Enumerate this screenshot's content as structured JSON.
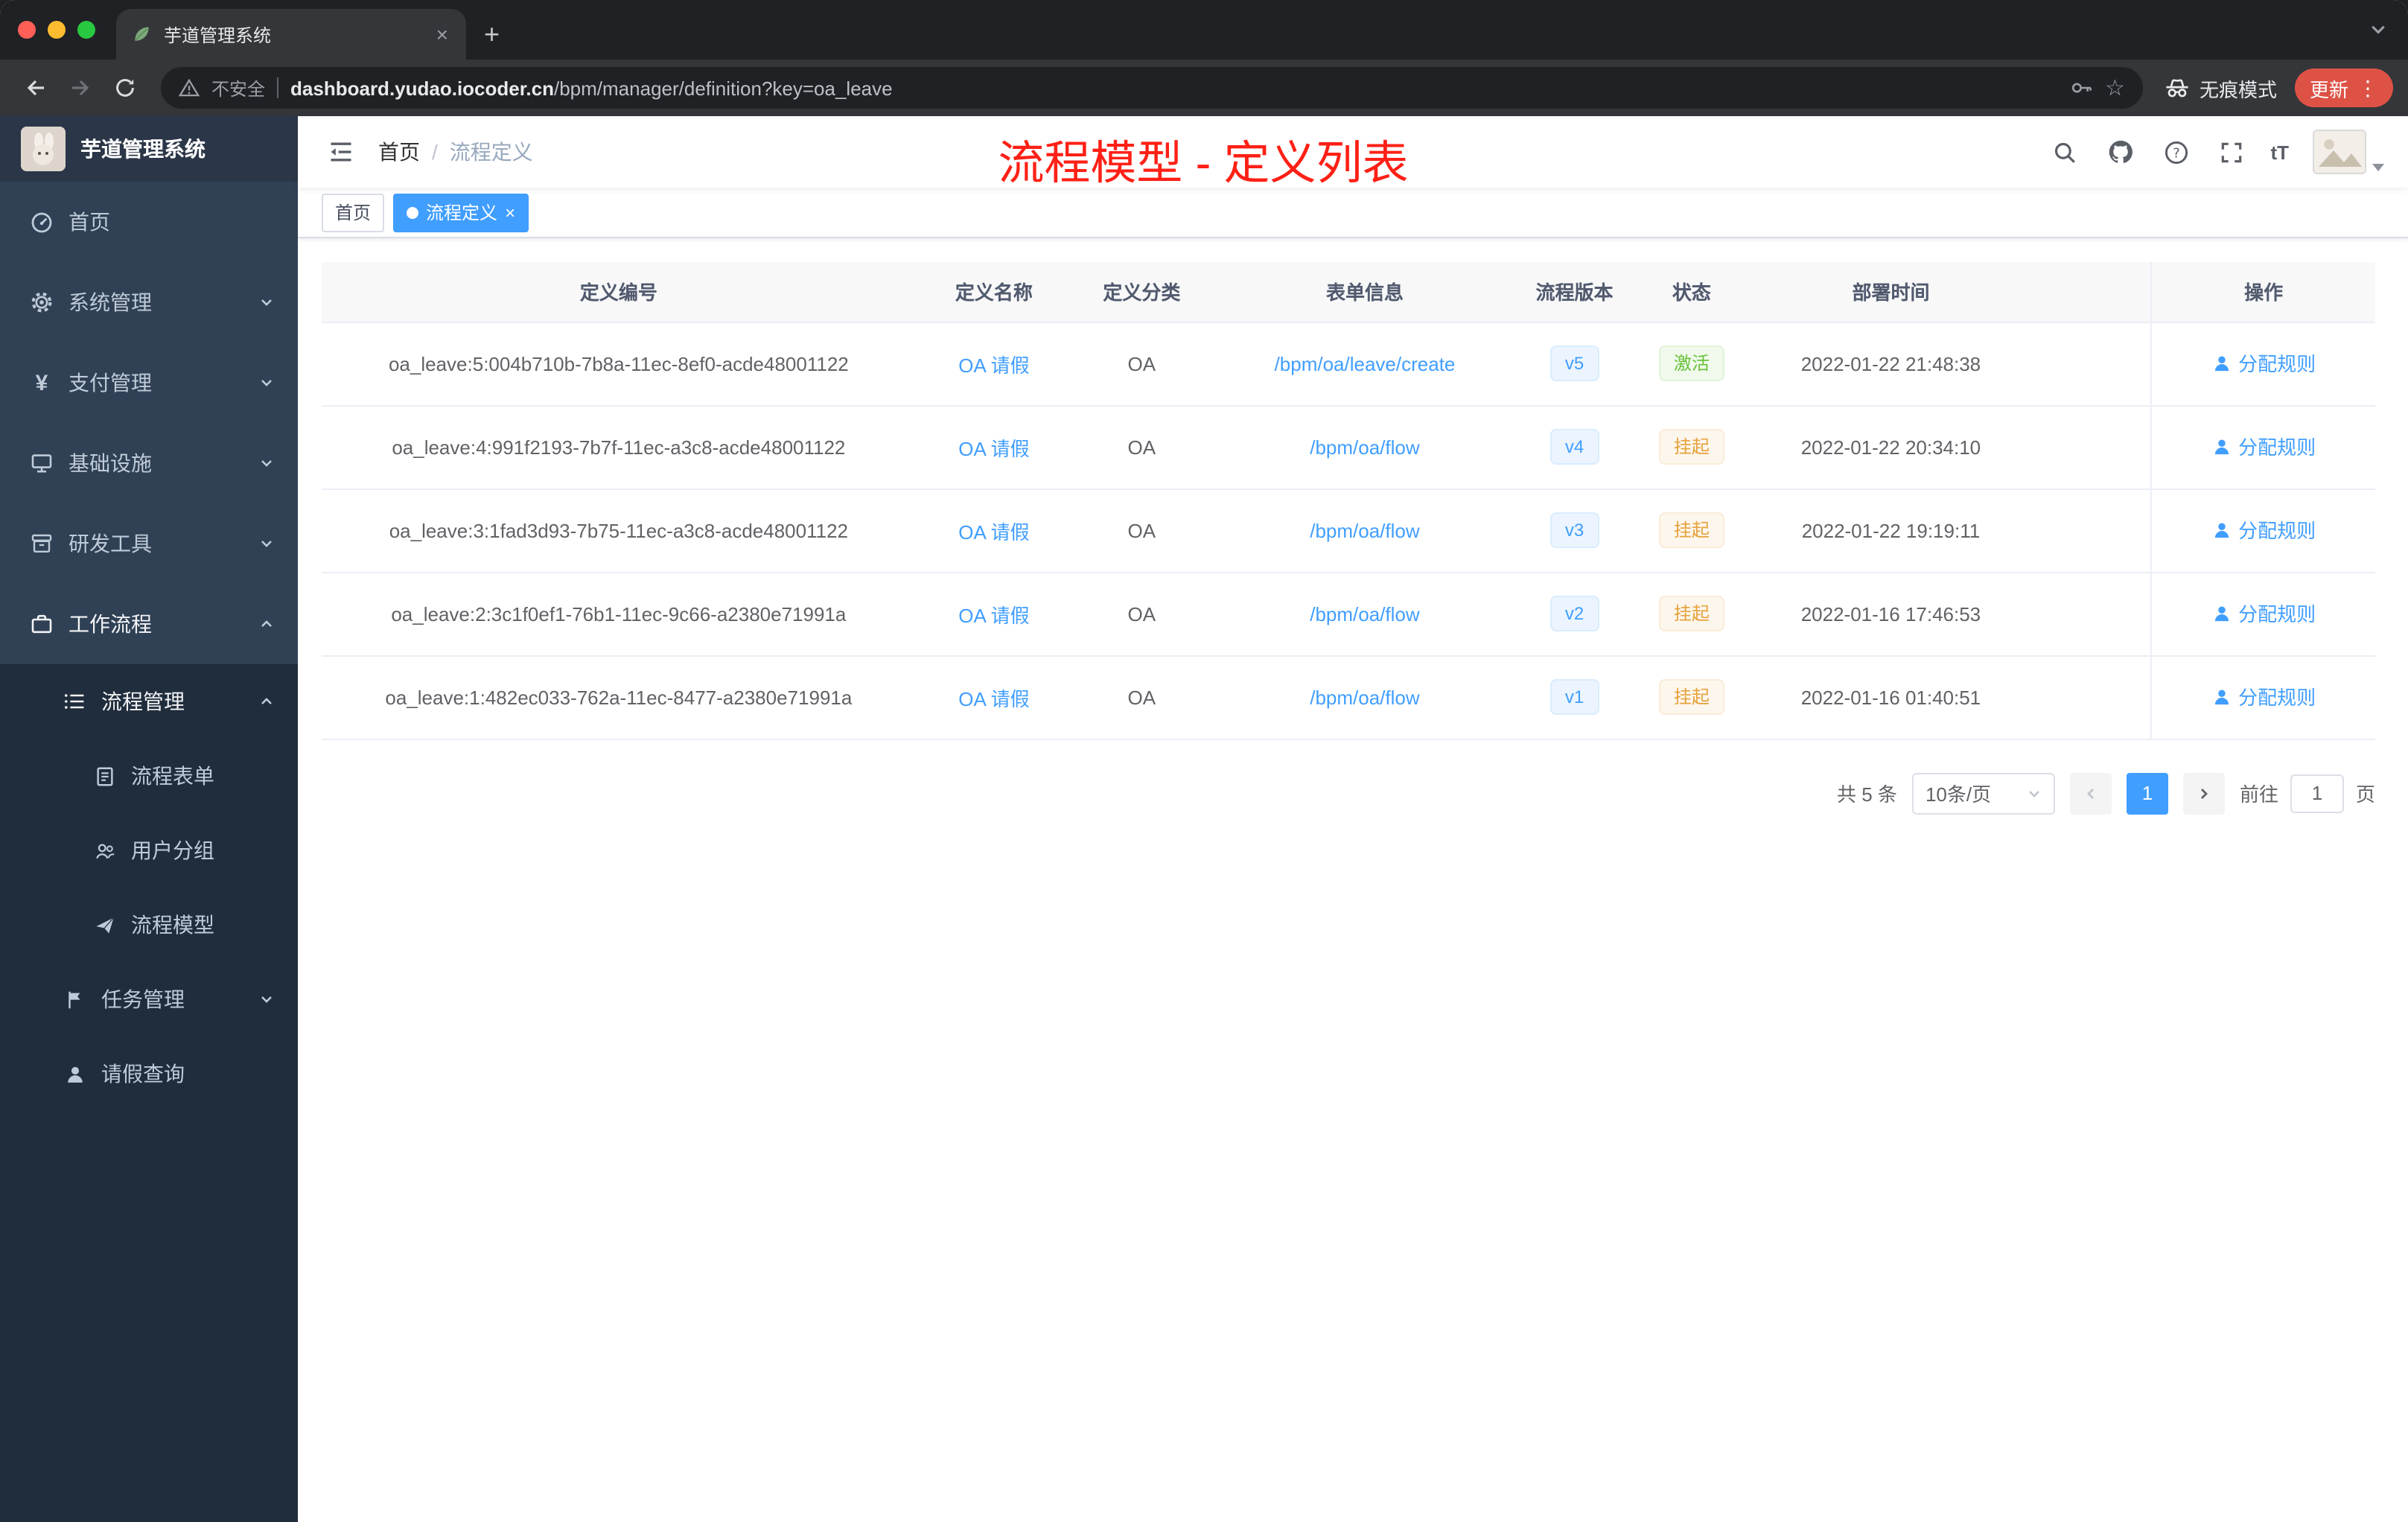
{
  "browser": {
    "tab": {
      "title": "芋道管理系统"
    },
    "security_label": "不安全",
    "url_domain": "dashboard.yudao.iocoder.cn",
    "url_path": "/bpm/manager/definition?key=oa_leave",
    "incognito_label": "无痕模式",
    "update_label": "更新"
  },
  "sidebar": {
    "logo_title": "芋道管理系统",
    "items": [
      {
        "label": "首页",
        "icon": "dashboard-icon"
      },
      {
        "label": "系统管理",
        "icon": "gear-icon",
        "chevron": "down"
      },
      {
        "label": "支付管理",
        "icon": "yen-icon",
        "icon_glyph": "¥",
        "chevron": "down"
      },
      {
        "label": "基础设施",
        "icon": "infrastructure-icon",
        "chevron": "down"
      },
      {
        "label": "研发工具",
        "icon": "toolbox-icon",
        "chevron": "down"
      },
      {
        "label": "工作流程",
        "icon": "workflow-icon",
        "chevron": "up"
      },
      {
        "label": "流程管理",
        "icon": "list-icon",
        "chevron": "up"
      },
      {
        "label": "流程表单",
        "icon": "form-icon"
      },
      {
        "label": "用户分组",
        "icon": "user-group-icon"
      },
      {
        "label": "流程模型",
        "icon": "paper-plane-icon"
      },
      {
        "label": "任务管理",
        "icon": "task-icon",
        "chevron": "down"
      },
      {
        "label": "请假查询",
        "icon": "person-icon"
      }
    ]
  },
  "header": {
    "breadcrumb": {
      "home": "首页",
      "separator": "/",
      "current": "流程定义"
    },
    "annotation": "流程模型 - 定义列表",
    "font_size_icon_label": "tT",
    "icons": [
      "search-icon",
      "github-icon",
      "help-icon",
      "fullscreen-icon",
      "font-size-icon",
      "avatar"
    ]
  },
  "tags": {
    "home_label": "首页",
    "active_label": "流程定义"
  },
  "table": {
    "columns": {
      "id": "定义编号",
      "name": "定义名称",
      "category": "定义分类",
      "form": "表单信息",
      "version": "流程版本",
      "status": "状态",
      "time": "部署时间",
      "action": "操作"
    },
    "rows": [
      {
        "id": "oa_leave:5:004b710b-7b8a-11ec-8ef0-acde48001122",
        "name": "OA 请假",
        "category": "OA",
        "form": "/bpm/oa/leave/create",
        "version": "v5",
        "status": "激活",
        "time": "2022-01-22 21:48:38",
        "action": "分配规则"
      },
      {
        "id": "oa_leave:4:991f2193-7b7f-11ec-a3c8-acde48001122",
        "name": "OA 请假",
        "category": "OA",
        "form": "/bpm/oa/flow",
        "version": "v4",
        "status": "挂起",
        "time": "2022-01-22 20:34:10",
        "action": "分配规则"
      },
      {
        "id": "oa_leave:3:1fad3d93-7b75-11ec-a3c8-acde48001122",
        "name": "OA 请假",
        "category": "OA",
        "form": "/bpm/oa/flow",
        "version": "v3",
        "status": "挂起",
        "time": "2022-01-22 19:19:11",
        "action": "分配规则"
      },
      {
        "id": "oa_leave:2:3c1f0ef1-76b1-11ec-9c66-a2380e71991a",
        "name": "OA 请假",
        "category": "OA",
        "form": "/bpm/oa/flow",
        "version": "v2",
        "status": "挂起",
        "time": "2022-01-16 17:46:53",
        "action": "分配规则"
      },
      {
        "id": "oa_leave:1:482ec033-762a-11ec-8477-a2380e71991a",
        "name": "OA 请假",
        "category": "OA",
        "form": "/bpm/oa/flow",
        "version": "v1",
        "status": "挂起",
        "time": "2022-01-16 01:40:51",
        "action": "分配规则"
      }
    ]
  },
  "pagination": {
    "total": "共 5 条",
    "page_size": "10条/页",
    "current_page": "1",
    "goto_label": "前往",
    "goto_value": "1",
    "goto_unit": "页"
  },
  "colors": {
    "accent": "#409EFF",
    "success": "#67C23A",
    "warning": "#E6A23C",
    "annotation_red": "#FE2016",
    "sidebar_bg": "#304156",
    "submenu_bg": "#1F2D3D"
  }
}
